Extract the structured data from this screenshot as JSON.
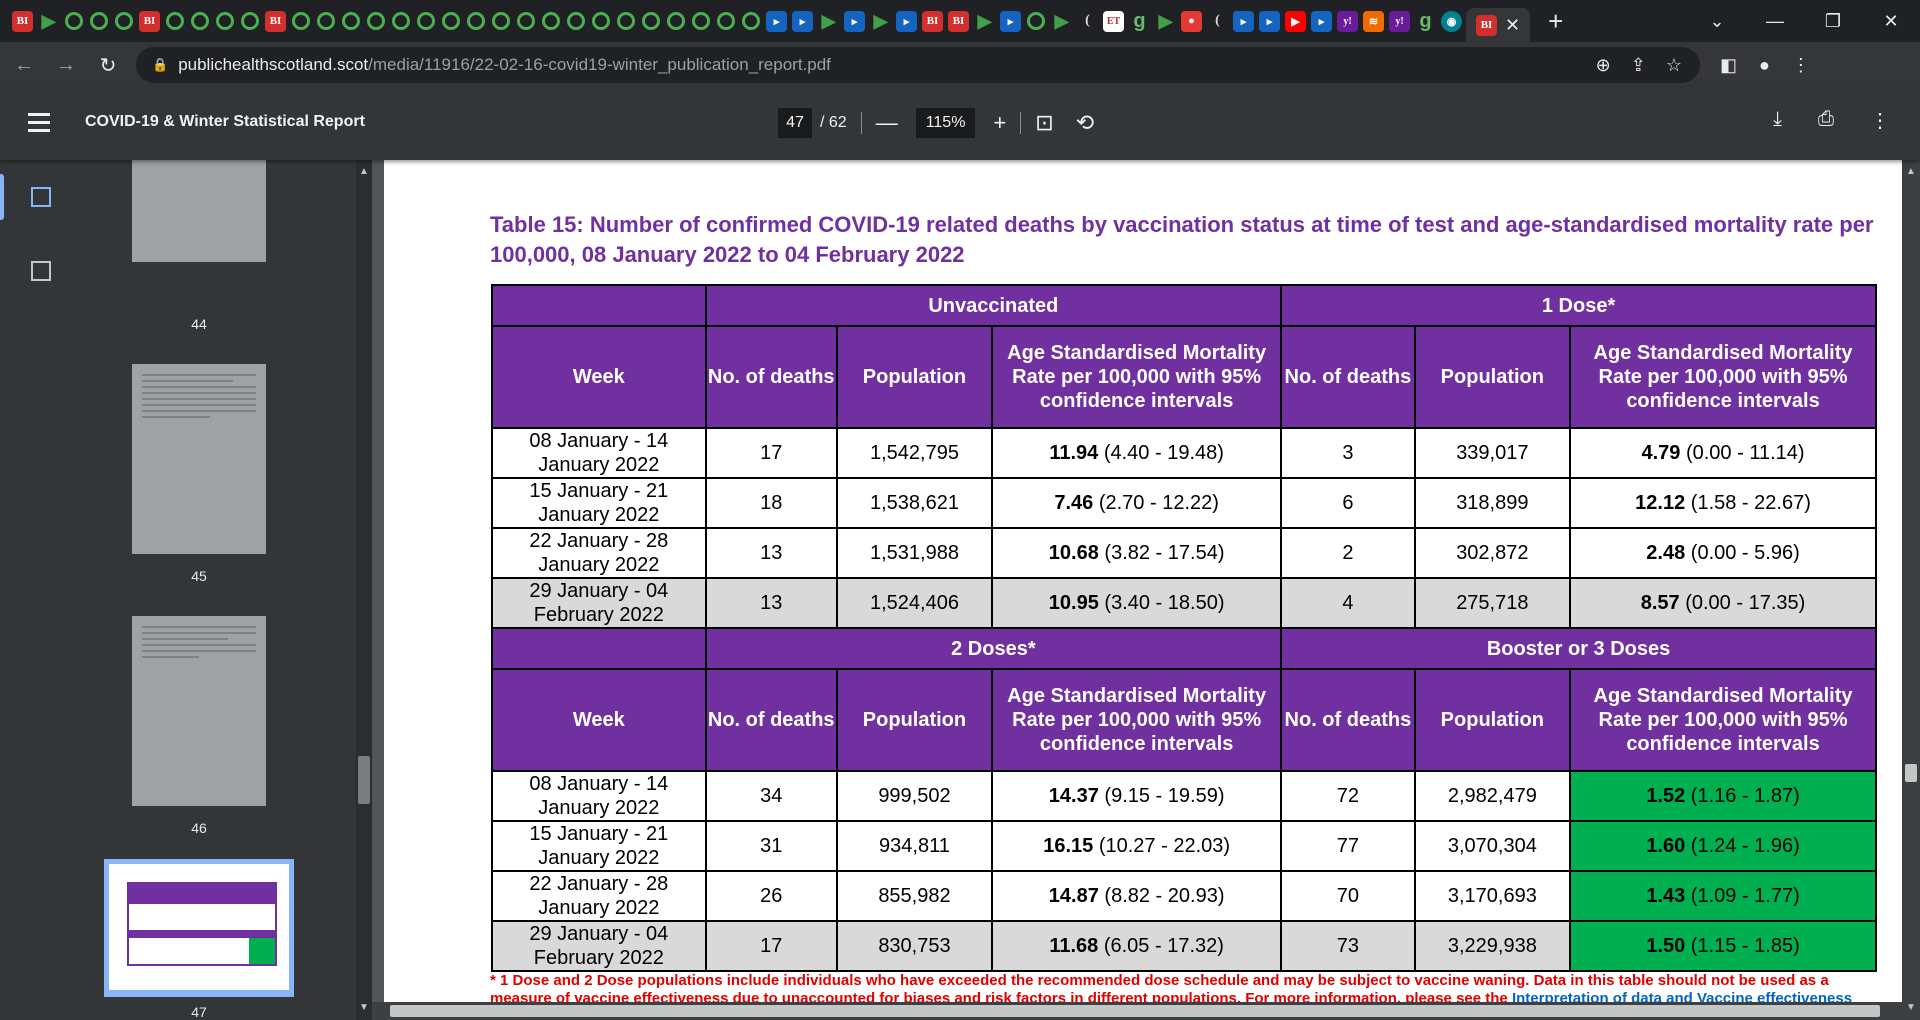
{
  "browser": {
    "tab_favicons": [
      "BI",
      "play",
      "circle",
      "circle",
      "circle",
      "BI",
      "circle",
      "circle",
      "circle",
      "circle",
      "BI",
      "circle",
      "circle",
      "circle",
      "circle",
      "circle",
      "circle",
      "circle",
      "circle",
      "circle",
      "circle",
      "circle",
      "circle",
      "circle",
      "circle",
      "circle",
      "circle",
      "circle",
      "circle",
      "circle",
      "nav",
      "nav",
      "play",
      "nav",
      "play",
      "nav",
      "BI",
      "BI",
      "play",
      "nav",
      "circle",
      "play",
      "C",
      "ET",
      "9",
      "play",
      "red",
      "C",
      "nav",
      "nav",
      "yt",
      "nav",
      "yh",
      "ora",
      "yh",
      "9",
      "teal"
    ],
    "active_tab_favicon": "BI",
    "new_tab_label": "+",
    "url_host": "publichealthscotland.scot",
    "url_path": "/media/11916/22-02-16-covid19-winter_publication_report.pdf"
  },
  "pdf_toolbar": {
    "title": "COVID-19 & Winter Statistical Report",
    "current_page": "47",
    "total_pages": "/ 62",
    "zoom": "115%"
  },
  "sidebar": {
    "thumbnails": [
      {
        "label": "44"
      },
      {
        "label": "45"
      },
      {
        "label": "46"
      },
      {
        "label": "47",
        "active": true
      }
    ]
  },
  "document": {
    "title": "Table 15: Number of confirmed COVID-19 related deaths by vaccination status at time of test and age-standardised mortality rate per 100,000, 08 January 2022 to 04 February 2022",
    "groups_top": {
      "left": "Unvaccinated",
      "right": "1 Dose*"
    },
    "groups_bottom": {
      "left": "2 Doses*",
      "right": "Booster or 3 Doses"
    },
    "headers": {
      "week": "Week",
      "deaths": "No. of deaths",
      "population": "Population",
      "asmr_left": "Age Standardised Mortality Rate per 100,000 with 95% confidence intervals",
      "asmr_right": "Age Standardised Mortality Rate per 100,000 with 95% confidence intervals"
    },
    "top_rows": [
      {
        "week": "08 January - 14 January 2022",
        "d1": "17",
        "p1": "1,542,795",
        "r1": "11.94",
        "ci1": "(4.40 - 19.48)",
        "d2": "3",
        "p2": "339,017",
        "r2": "4.79",
        "ci2": "(0.00 - 11.14)"
      },
      {
        "week": "15 January - 21 January 2022",
        "d1": "18",
        "p1": "1,538,621",
        "r1": "7.46",
        "ci1": "(2.70 - 12.22)",
        "d2": "6",
        "p2": "318,899",
        "r2": "12.12",
        "ci2": "(1.58 - 22.67)"
      },
      {
        "week": "22 January - 28 January 2022",
        "d1": "13",
        "p1": "1,531,988",
        "r1": "10.68",
        "ci1": "(3.82 - 17.54)",
        "d2": "2",
        "p2": "302,872",
        "r2": "2.48",
        "ci2": "(0.00 - 5.96)"
      },
      {
        "week": "29 January - 04 February 2022",
        "d1": "13",
        "p1": "1,524,406",
        "r1": "10.95",
        "ci1": "(3.40 - 18.50)",
        "d2": "4",
        "p2": "275,718",
        "r2": "8.57",
        "ci2": "(0.00 - 17.35)"
      }
    ],
    "bottom_rows": [
      {
        "week": "08 January - 14 January 2022",
        "d1": "34",
        "p1": "999,502",
        "r1": "14.37",
        "ci1": "(9.15 - 19.59)",
        "d2": "72",
        "p2": "2,982,479",
        "r2": "1.52",
        "ci2": "(1.16 - 1.87)"
      },
      {
        "week": "15 January - 21 January 2022",
        "d1": "31",
        "p1": "934,811",
        "r1": "16.15",
        "ci1": "(10.27 - 22.03)",
        "d2": "77",
        "p2": "3,070,304",
        "r2": "1.60",
        "ci2": "(1.24 - 1.96)"
      },
      {
        "week": "22 January - 28 January 2022",
        "d1": "26",
        "p1": "855,982",
        "r1": "14.87",
        "ci1": "(8.82 - 20.93)",
        "d2": "70",
        "p2": "3,170,693",
        "r2": "1.43",
        "ci2": "(1.09 - 1.77)"
      },
      {
        "week": "29 January - 04 February 2022",
        "d1": "17",
        "p1": "830,753",
        "r1": "11.68",
        "ci1": "(6.05 - 17.32)",
        "d2": "73",
        "p2": "3,229,938",
        "r2": "1.50",
        "ci2": "(1.15 - 1.85)"
      }
    ],
    "footnote": "* 1 Dose and 2 Dose populations include individuals who have exceeded the recommended dose schedule and may be subject to vaccine waning. Data in this table should not be used as a measure of vaccine effectiveness due to unaccounted for biases and risk factors in different populations. For more information, please see the",
    "footnote_link": "Interpretation of data and Vaccine effectiveness",
    "colors": {
      "header_purple": "#7030a0",
      "highlight_green": "#00b050",
      "shade_grey": "#d9d9d9",
      "footnote_red": "#e00000"
    }
  }
}
